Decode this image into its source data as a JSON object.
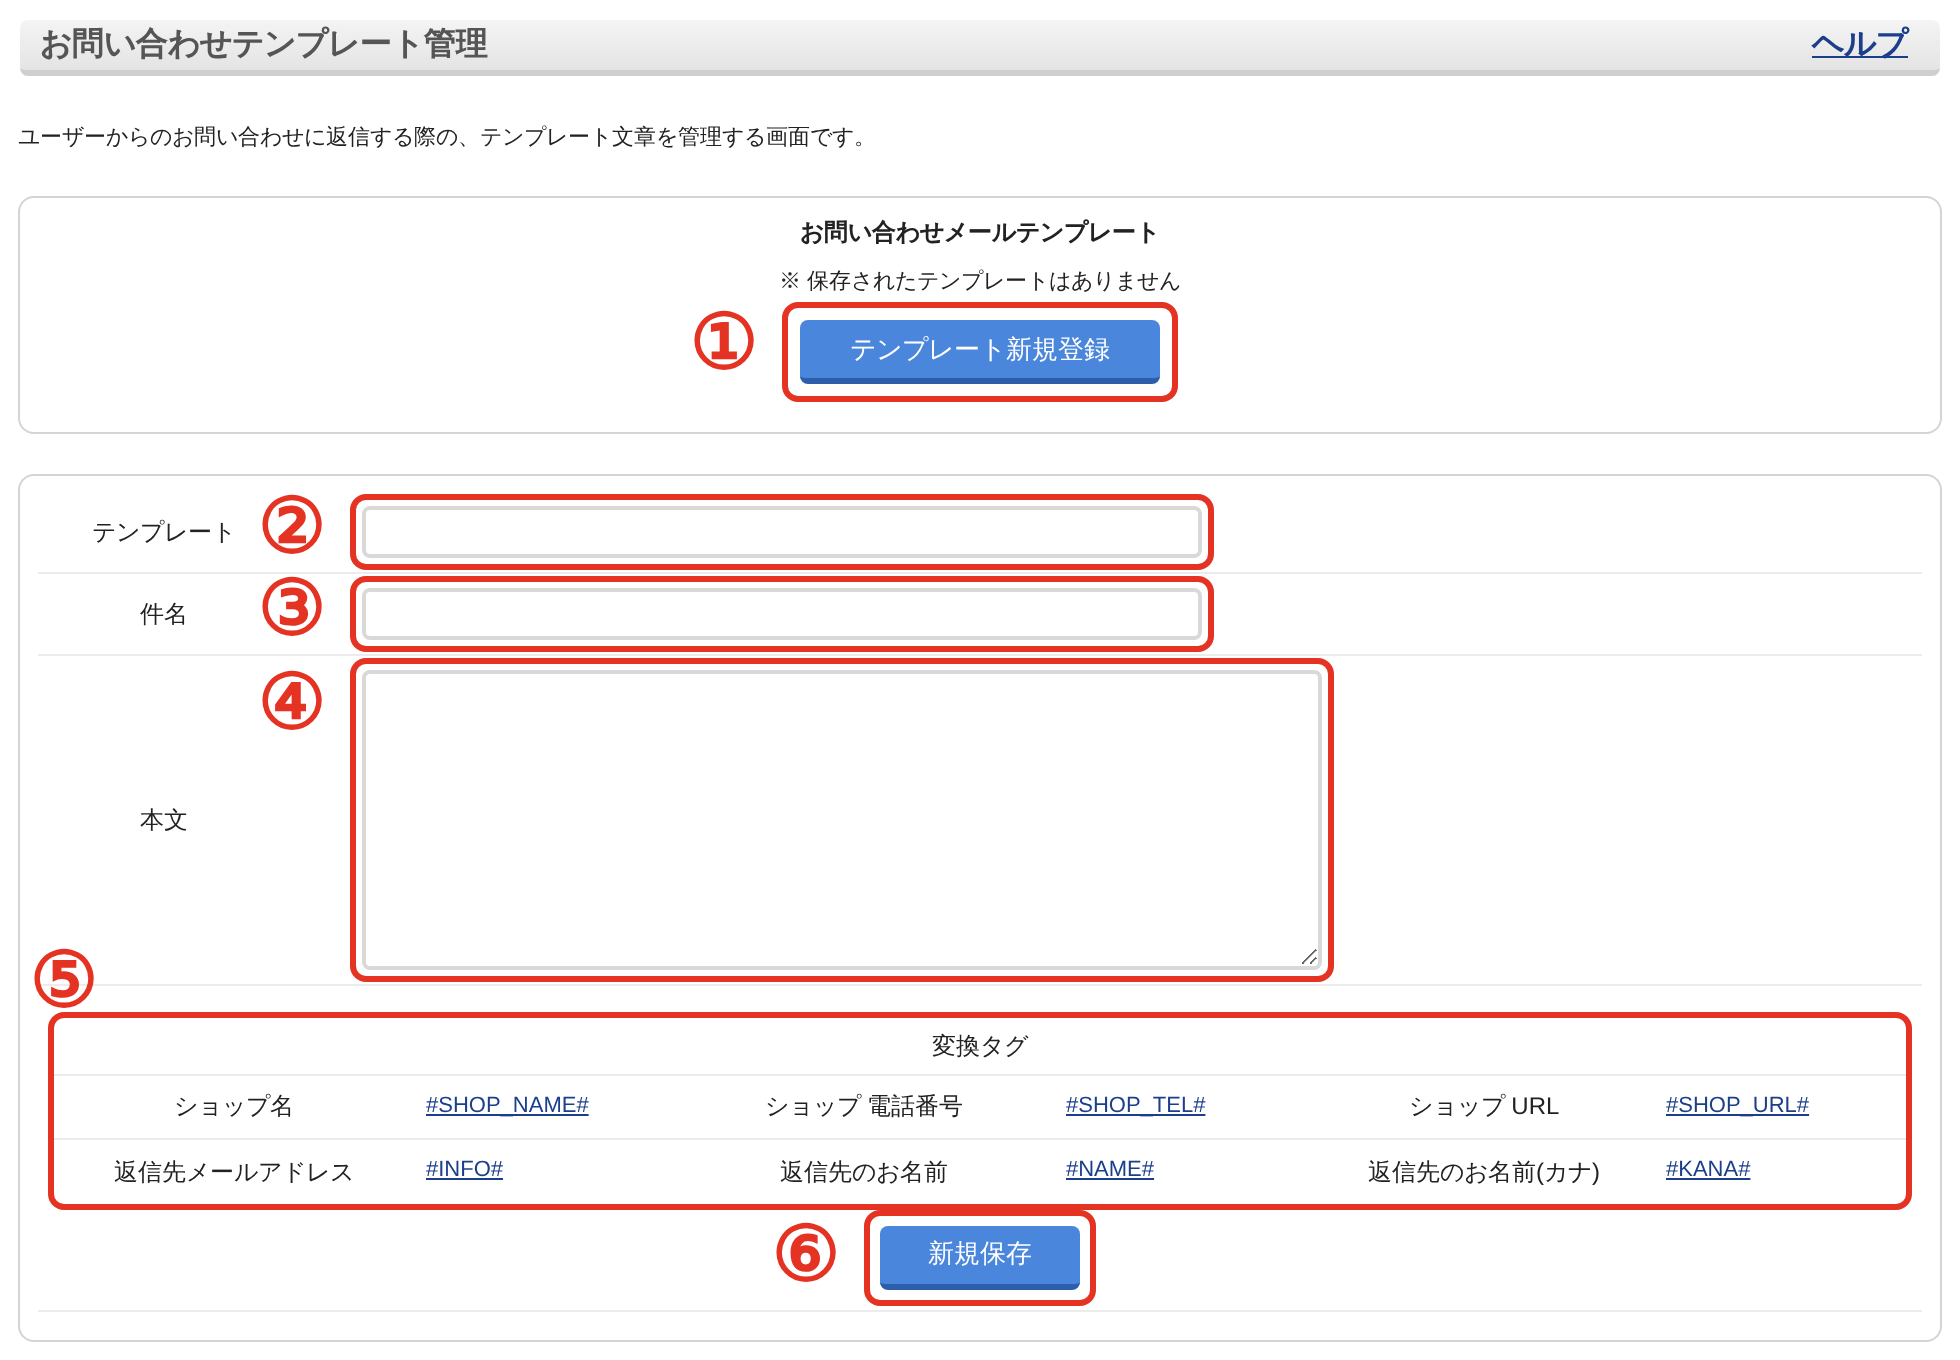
{
  "header": {
    "title": "お問い合わせテンプレート管理",
    "help_link": "ヘルプ"
  },
  "description": "ユーザーからのお問い合わせに返信する際の、テンプレート文章を管理する画面です。",
  "template_list": {
    "title": "お問い合わせメールテンプレート",
    "notice": "※ 保存されたテンプレートはありません",
    "button": "テンプレート新規登録",
    "marker": "①"
  },
  "form": {
    "fields": [
      {
        "kind": "input",
        "label": "テンプレート",
        "marker": "②"
      },
      {
        "kind": "input",
        "label": "件名",
        "marker": "③"
      },
      {
        "kind": "textarea",
        "label": "本文",
        "marker": "④"
      }
    ],
    "tags": {
      "title": "変換タグ",
      "marker": "⑤",
      "rows": [
        [
          {
            "label": "ショップ名",
            "tag": "#SHOP_NAME#"
          },
          {
            "label": "ショップ 電話番号",
            "tag": "#SHOP_TEL#"
          },
          {
            "label": "ショップ URL",
            "tag": "#SHOP_URL#"
          }
        ],
        [
          {
            "label": "返信先メールアドレス",
            "tag": "#INFO#"
          },
          {
            "label": "返信先のお名前",
            "tag": "#NAME#"
          },
          {
            "label": "返信先のお名前(カナ)",
            "tag": "#KANA#"
          }
        ]
      ]
    },
    "save_button": "新規保存",
    "save_marker": "⑥"
  }
}
